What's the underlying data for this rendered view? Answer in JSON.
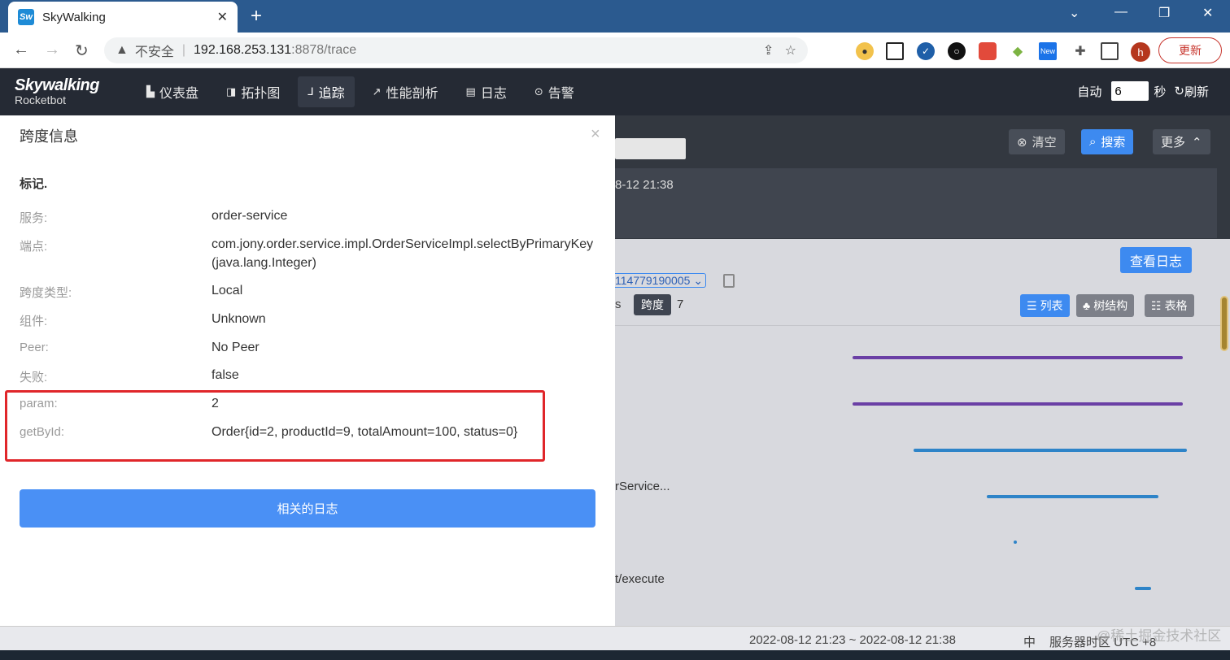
{
  "browser": {
    "tab_title": "SkyWalking",
    "favicon_text": "Sw",
    "insecure_label": "不安全",
    "url_host": "192.168.253.131",
    "url_path": ":8878/trace",
    "update_label": "更新",
    "profile_initial": "h"
  },
  "app": {
    "logo_line1": "Skywalking",
    "logo_line2": "Rocketbot",
    "nav": [
      {
        "label": "仪表盘",
        "icon": "chart-icon"
      },
      {
        "label": "拓扑图",
        "icon": "topology-icon"
      },
      {
        "label": "追踪",
        "icon": "trace-icon"
      },
      {
        "label": "性能剖析",
        "icon": "profile-icon"
      },
      {
        "label": "日志",
        "icon": "log-icon"
      },
      {
        "label": "告警",
        "icon": "alert-icon"
      }
    ],
    "auto_label": "自动",
    "auto_value": "6",
    "seconds_label": "秒",
    "refresh_label": "刷新"
  },
  "toolbar": {
    "clear_label": "清空",
    "search_label": "搜索",
    "more_label": "更多",
    "time_fragment": "8-12 21:38"
  },
  "trace": {
    "view_log_label": "查看日志",
    "trace_id_fragment": "114779190005",
    "span_prefix": "s",
    "span_label": "跨度",
    "span_count": "7",
    "view_list": "列表",
    "view_tree": "树结构",
    "view_table": "表格",
    "row_label_1": "rService...",
    "row_label_2": "t/execute"
  },
  "footer": {
    "range": "2022-08-12 21:23 ~ 2022-08-12 21:38",
    "lang": "中",
    "timezone": "服务器时区 UTC +8"
  },
  "watermark": "@稀土掘金技术社区",
  "modal": {
    "title": "跨度信息",
    "close": "×",
    "section": "标记.",
    "rows": [
      {
        "key": "服务:",
        "value": "order-service"
      },
      {
        "key": "端点:",
        "value": "com.jony.order.service.impl.OrderServiceImpl.selectByPrimaryKey(java.lang.Integer)"
      },
      {
        "key": "跨度类型:",
        "value": "Local"
      },
      {
        "key": "组件:",
        "value": "Unknown"
      },
      {
        "key": "Peer:",
        "value": "No Peer"
      },
      {
        "key": "失败:",
        "value": "false"
      },
      {
        "key": "param:",
        "value": "2"
      },
      {
        "key": "getById:",
        "value": "Order{id=2, productId=9, totalAmount=100, status=0}"
      }
    ],
    "related_logs_label": "相关的日志"
  },
  "colors": {
    "accent": "#3d8af0",
    "header_bg": "#252a34",
    "highlight": "#e0262a"
  }
}
